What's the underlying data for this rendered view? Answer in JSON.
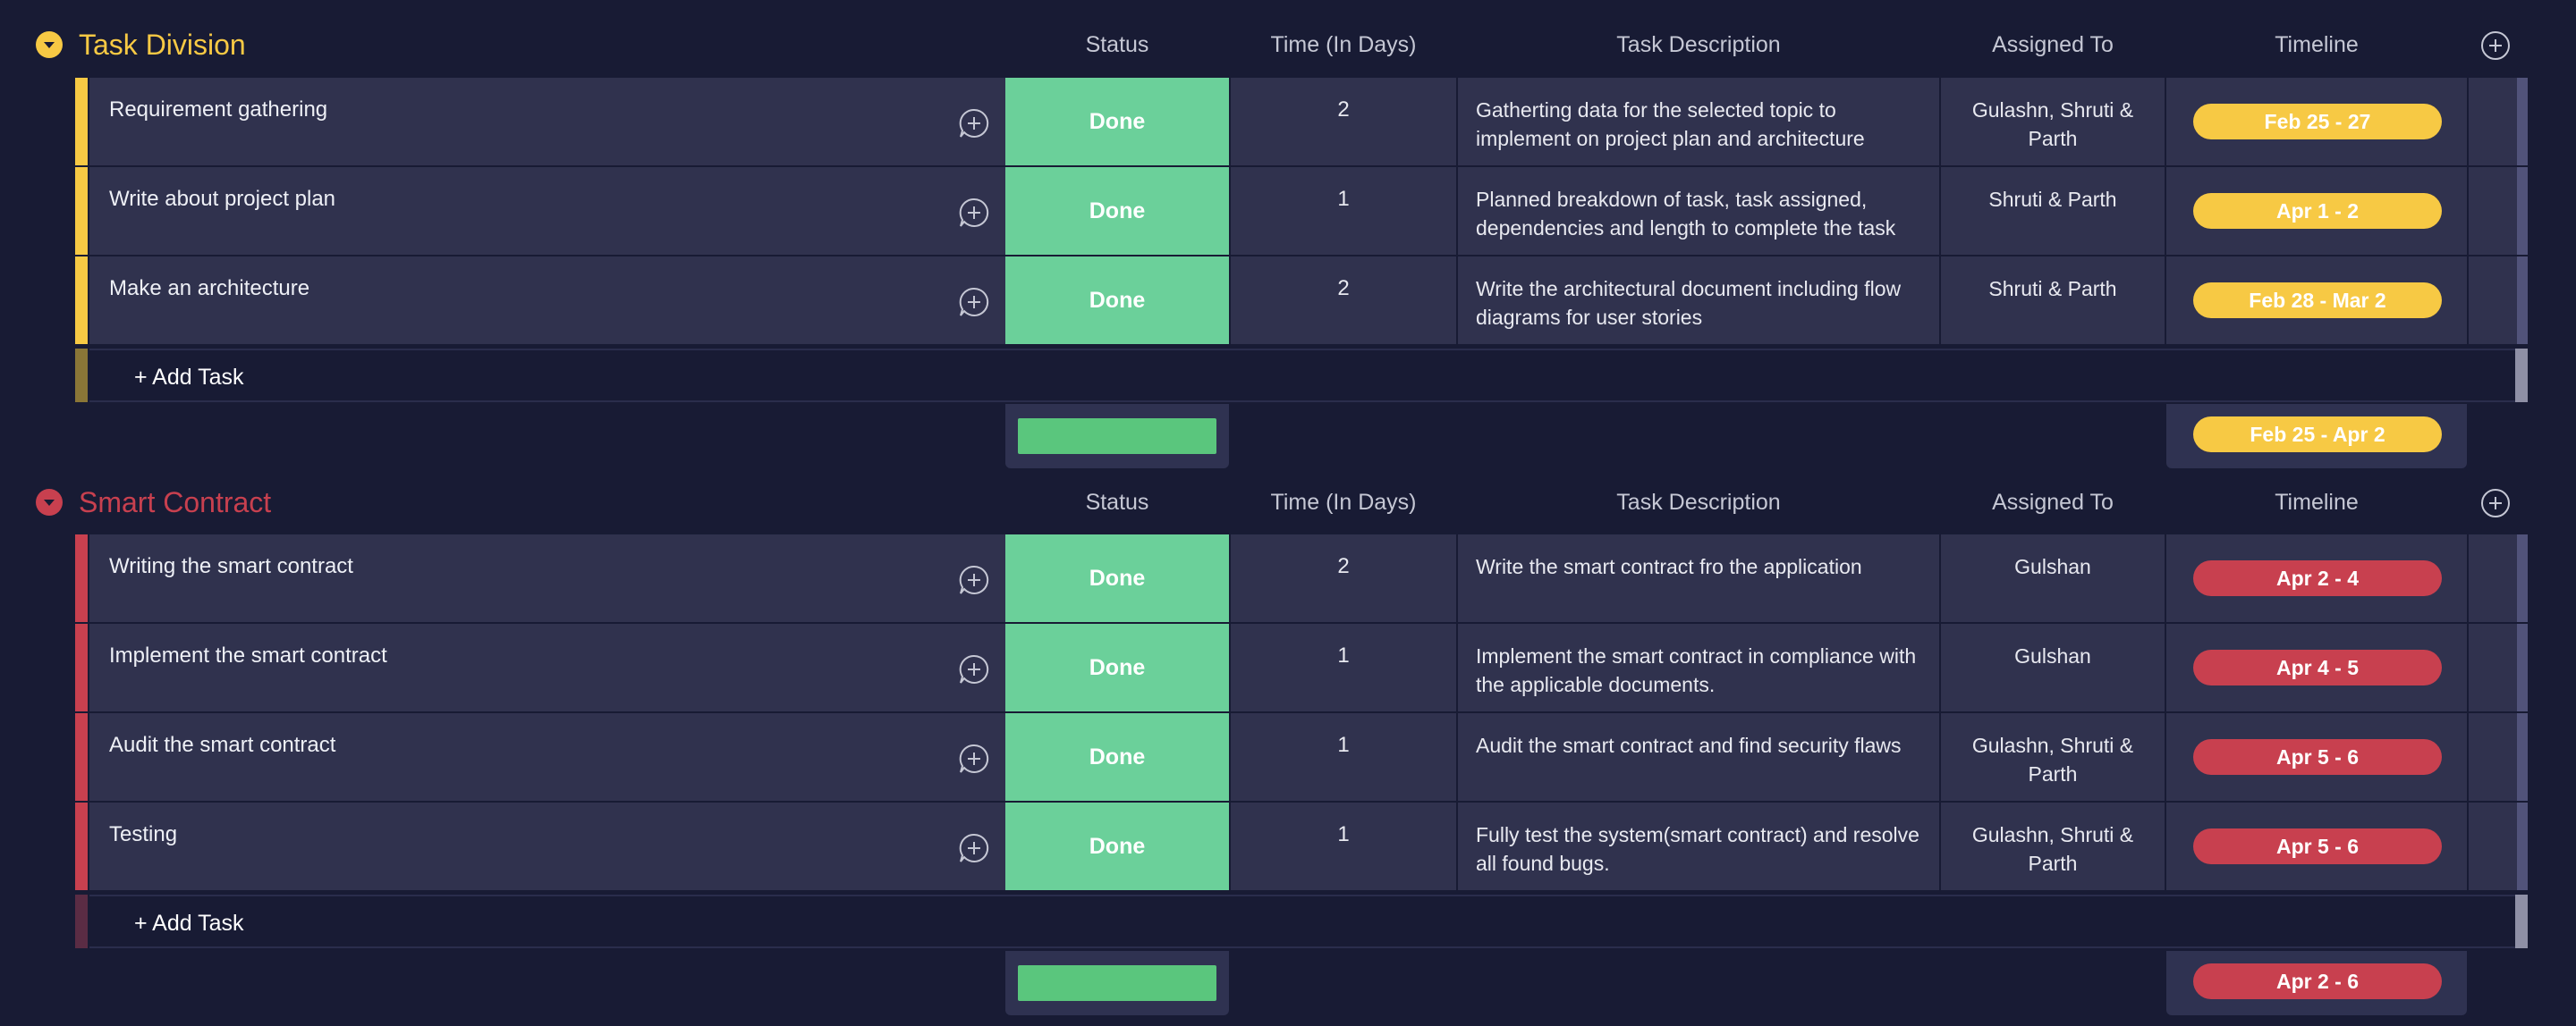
{
  "colors": {
    "background": "#181b34",
    "group1_accent": "#f7c944",
    "group2_accent": "#c8404f",
    "status_done": "#6bd09a",
    "summary_status_bar": "#5ac67d",
    "row_bg": "#30324e"
  },
  "columns": {
    "status": "Status",
    "time": "Time (In Days)",
    "description": "Task Description",
    "assigned": "Assigned To",
    "timeline": "Timeline"
  },
  "groups": [
    {
      "title": "Task Division",
      "add_task_label": "+ Add Task",
      "summary_timeline": "Feb 25 - Apr 2",
      "rows": [
        {
          "name": "Requirement gathering",
          "status": "Done",
          "days": "2",
          "description": "Gatherting data for the selected topic to implement on project plan and architecture",
          "assigned": "Gulashn, Shruti & Parth",
          "timeline": "Feb 25 - 27"
        },
        {
          "name": "Write about project plan",
          "status": "Done",
          "days": "1",
          "description": "Planned breakdown of task, task assigned, dependencies and length to complete the task",
          "assigned": "Shruti & Parth",
          "timeline": "Apr 1 - 2"
        },
        {
          "name": "Make an architecture",
          "status": "Done",
          "days": "2",
          "description": "Write the architectural document including flow diagrams for user stories",
          "assigned": "Shruti & Parth",
          "timeline": "Feb 28 - Mar 2"
        }
      ]
    },
    {
      "title": "Smart Contract",
      "add_task_label": "+ Add Task",
      "summary_timeline": "Apr 2 - 6",
      "rows": [
        {
          "name": "Writing the smart contract",
          "status": "Done",
          "days": "2",
          "description": "Write the smart contract fro the application",
          "assigned": "Gulshan",
          "timeline": "Apr 2 - 4"
        },
        {
          "name": "Implement the smart contract",
          "status": "Done",
          "days": "1",
          "description": "Implement the smart contract in compliance with the applicable documents.",
          "assigned": "Gulshan",
          "timeline": "Apr 4 - 5"
        },
        {
          "name": "Audit the smart contract",
          "status": "Done",
          "days": "1",
          "description": "Audit the smart contract and find security flaws",
          "assigned": "Gulashn, Shruti & Parth",
          "timeline": "Apr 5 - 6"
        },
        {
          "name": "Testing",
          "status": "Done",
          "days": "1",
          "description": "Fully test the system(smart contract) and resolve all found bugs.",
          "assigned": "Gulashn, Shruti & Parth",
          "timeline": "Apr 5 - 6"
        }
      ]
    }
  ]
}
